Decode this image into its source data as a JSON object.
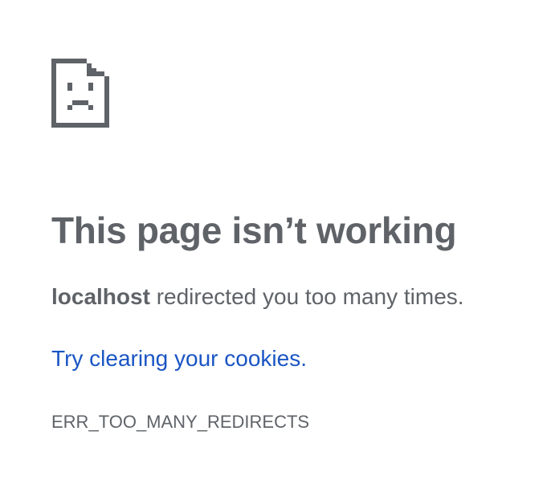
{
  "error_page": {
    "icon": "sad-page-icon",
    "heading": "This page isn’t working",
    "message": {
      "host": "localhost",
      "text": " redirected you too many times."
    },
    "suggestion_link": "Try clearing your cookies.",
    "error_code": "ERR_TOO_MANY_REDIRECTS"
  },
  "colors": {
    "text": "#5f6368",
    "link": "#1a55c4",
    "background": "#ffffff"
  }
}
